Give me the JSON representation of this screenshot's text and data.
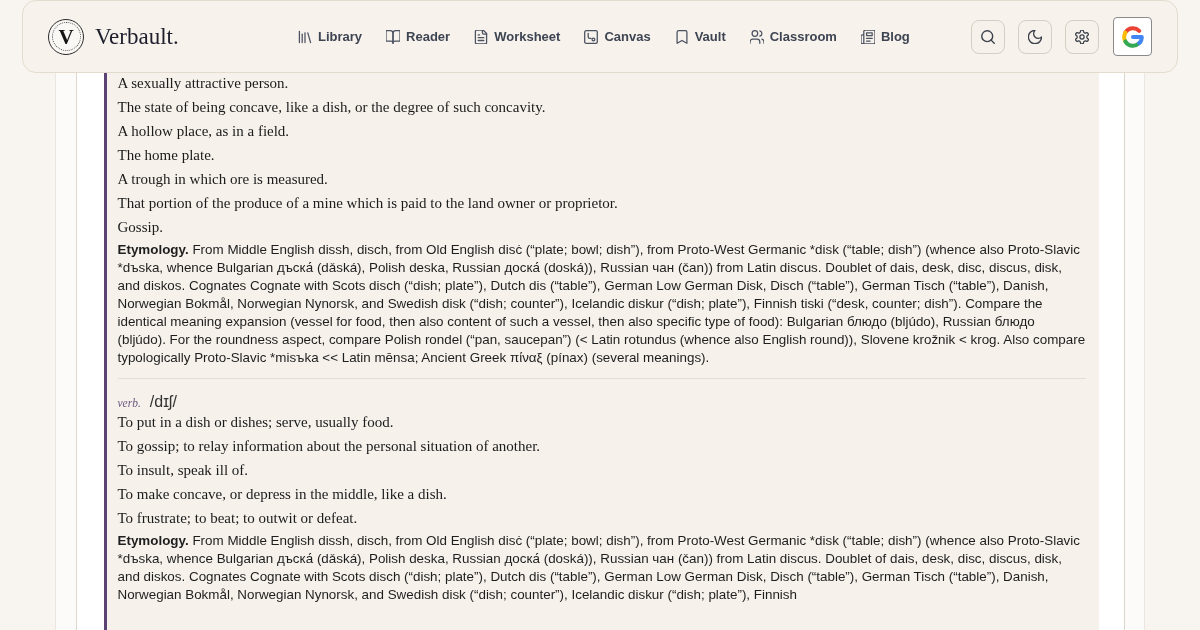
{
  "top_bar": {
    "logo": {
      "monogram": "V",
      "wordmark": "Verbault."
    },
    "nav": [
      "Library",
      "Reader",
      "Worksheet",
      "Canvas",
      "Vault",
      "Classroom",
      "Blog"
    ],
    "buttons": [
      {
        "kind": "search"
      },
      {
        "kind": "theme"
      },
      {
        "kind": "settings"
      },
      {
        "kind": "account"
      }
    ]
  },
  "entry": {
    "sections": [
      {
        "definitions": [
          "A sexually attractive person.",
          "The state of being concave, like a dish, or the degree of such concavity.",
          "A hollow place, as in a field.",
          "The home plate.",
          "A trough in which ore is measured.",
          "That portion of the produce of a mine which is paid to the land owner or proprietor.",
          "Gossip."
        ],
        "etymology": {
          "label": "Etymology.",
          "text": "From Middle English dissh, disch, from Old English disċ (“plate; bowl; dish”), from Proto-West Germanic *disk (“table; dish”) (whence also Proto-Slavic *dъska, whence Bulgarian дъска́ (dǎská), Polish deska, Russian доска́ (doská)), Russian чан (čan)) from Latin discus. Doublet of dais, desk, disc, discus, disk, and diskos. Cognates Cognate with Scots disch (“dish; plate”), Dutch dis (“table”), German Low German Disk, Disch (“table”), German Tisch (“table”), Danish, Norwegian Bokmål, Norwegian Nynorsk, and Swedish disk (“dish; counter”), Icelandic diskur (“dish; plate”), Finnish tiski (“desk, counter; dish”). Compare the identical meaning expansion (vessel for food, then also content of such a vessel, then also specific type of food): Bulgarian блюдо (bljúdo), Russian блюдо (bljúdo). For the roundness aspect, compare Polish rondel (“pan, saucepan”) (< Latin rotundus (whence also English round)), Slovene krožnik < krog. Also compare typologically Proto-Slavic *misъka << Latin mēnsa; Ancient Greek πίναξ (pínax) (several meanings)."
        }
      },
      {
        "part_of_speech": "verb.",
        "pronunciation": "/dɪʃ/",
        "definitions": [
          "To put in a dish or dishes; serve, usually food.",
          "To gossip; to relay information about the personal situation of another.",
          "To insult, speak ill of.",
          "To make concave, or depress in the middle, like a dish.",
          "To frustrate; to beat; to outwit or defeat."
        ],
        "etymology": {
          "label": "Etymology.",
          "text": "From Middle English dissh, disch, from Old English disċ (“plate; bowl; dish”), from Proto-West Germanic *disk (“table; dish”) (whence also Proto-Slavic *dъska, whence Bulgarian дъска́ (dǎská), Polish deska, Russian доска́ (doská)), Russian чан (čan)) from Latin discus. Doublet of dais, desk, disc, discus, disk, and diskos. Cognates Cognate with Scots disch (“dish; plate”), Dutch dis (“table”), German Low German Disk, Disch (“table”), German Tisch (“table”), Danish, Norwegian Bokmål, Norwegian Nynorsk, and Swedish disk (“dish; counter”), Icelandic diskur (“dish; plate”), Finnish"
        }
      }
    ]
  }
}
